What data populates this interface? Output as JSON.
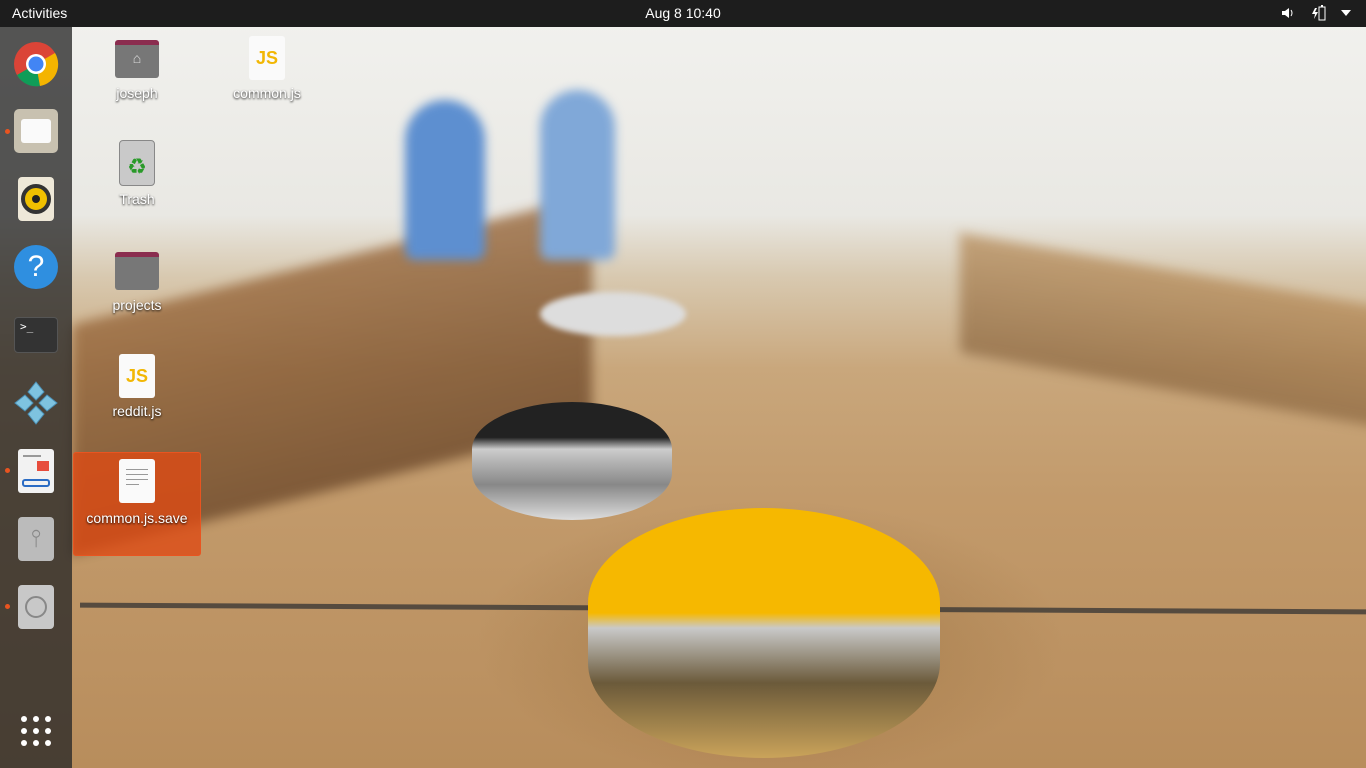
{
  "topbar": {
    "activities": "Activities",
    "clock": "Aug 8  10:40",
    "tray": [
      "volume-icon",
      "battery-icon",
      "system-menu-chevron-icon"
    ]
  },
  "dock": {
    "items": [
      {
        "name": "Google Chrome",
        "running": false
      },
      {
        "name": "Files",
        "running": true
      },
      {
        "name": "Rhythmbox",
        "running": false
      },
      {
        "name": "Help",
        "running": false
      },
      {
        "name": "Terminal",
        "running": false
      },
      {
        "name": "PPSSPP",
        "running": false
      },
      {
        "name": "Document Viewer",
        "running": true
      },
      {
        "name": "USB Drive",
        "running": false
      },
      {
        "name": "Optical Disc",
        "running": true
      },
      {
        "name": "Show Applications",
        "running": false
      }
    ]
  },
  "desktop": {
    "icons": [
      {
        "label": "joseph",
        "type": "home-folder"
      },
      {
        "label": "common.js",
        "type": "js",
        "glyph": "JS"
      },
      {
        "label": "Trash",
        "type": "trash"
      },
      {
        "label": "projects",
        "type": "folder"
      },
      {
        "label": "reddit.js",
        "type": "js",
        "glyph": "JS"
      },
      {
        "label": "common.js.save",
        "type": "text",
        "selected": true
      }
    ]
  },
  "colors": {
    "accent": "#e95420",
    "topbar": "#1d1d1d"
  }
}
